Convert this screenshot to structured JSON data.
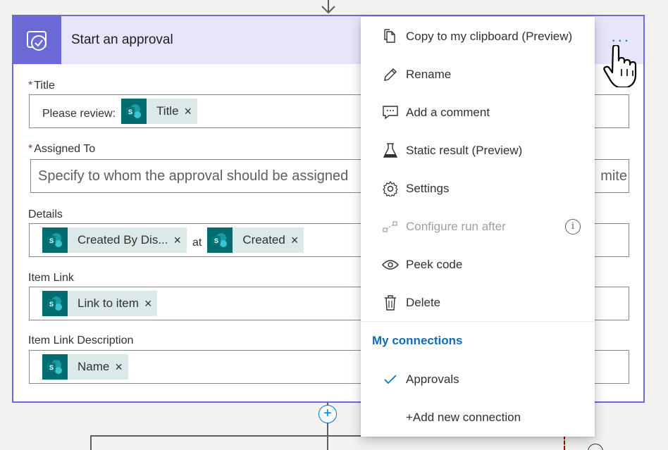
{
  "card": {
    "title": "Start an approval",
    "more_label": "...",
    "accent_color": "#6b69d6",
    "fields": {
      "title": {
        "label": "Title",
        "required_marker": "*",
        "prefix_text": "Please review:",
        "token": "Title"
      },
      "assigned_to": {
        "label": "Assigned To",
        "required_marker": "*",
        "placeholder": "Specify to whom the approval should be assigned",
        "overflow_tail": "mite"
      },
      "details": {
        "label": "Details",
        "token1": "Created By Dis...",
        "joiner": "at",
        "token2": "Created"
      },
      "item_link": {
        "label": "Item Link",
        "token": "Link to item"
      },
      "item_link_description": {
        "label": "Item Link Description",
        "token": "Name"
      }
    },
    "token_remove": "×",
    "sharepoint_letter": "S"
  },
  "menu": {
    "items": [
      {
        "label": "Copy to my clipboard (Preview)",
        "icon": "copy-icon"
      },
      {
        "label": "Rename",
        "icon": "pencil-icon"
      },
      {
        "label": "Add a comment",
        "icon": "comment-icon"
      },
      {
        "label": "Static result (Preview)",
        "icon": "flask-icon"
      },
      {
        "label": "Settings",
        "icon": "gear-icon"
      },
      {
        "label": "Configure run after",
        "icon": "run-after-icon",
        "disabled": true,
        "info": "i"
      },
      {
        "label": "Peek code",
        "icon": "eye-icon"
      },
      {
        "label": "Delete",
        "icon": "trash-icon"
      }
    ],
    "section_title": "My connections",
    "connections": [
      {
        "label": "Approvals",
        "checked": true
      },
      {
        "label": "+Add new connection"
      }
    ],
    "link_color": "#0f6cbd"
  },
  "connector": {
    "add_label": "+"
  }
}
